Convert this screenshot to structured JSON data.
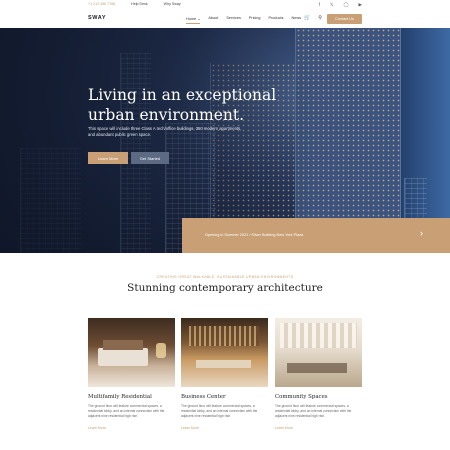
{
  "topbar": {
    "links": [
      "+1 212 456 7788",
      "Help Desk",
      "Why Sway"
    ],
    "social_icons": [
      "facebook-icon",
      "twitter-icon",
      "instagram-icon",
      "youtube-icon"
    ]
  },
  "nav": {
    "logo": "SWAY",
    "menu": [
      "Home",
      "About",
      "Services",
      "Pricing",
      "Products",
      "News"
    ],
    "contact_label": "Contact Us"
  },
  "hero": {
    "title": "Living in an exceptional urban environment.",
    "description": "This space will include three Class A tech/office buildings, 350 modern apartments, and abundant public green space.",
    "learn_more": "Learn More",
    "get_started": "Get Started",
    "ribbon_text": "Opening in Summer 2021 / Silver Building New York Plaza"
  },
  "section": {
    "eyebrow": "CREATING GREAT WALKABLE, SUSTAINABLE URBAN ENVIRONMENTS",
    "title": "Stunning contemporary architecture"
  },
  "cards": [
    {
      "title": "Multifamily Residential",
      "text": "The ground floor will feature commercial spaces, a residential lobby, and an internal connection with the adjacent nine residential high rise.",
      "link": "Learn More"
    },
    {
      "title": "Business Center",
      "text": "The ground floor will feature commercial spaces, a residential lobby, and an internal connection with the adjacent nine residential high rise.",
      "link": "Learn More"
    },
    {
      "title": "Community Spaces",
      "text": "The ground floor will feature commercial spaces, a residential lobby, and an internal connection with the adjacent nine residential high rise.",
      "link": "Learn More"
    }
  ],
  "colors": {
    "accent": "#c9a075",
    "hero_dark": "#1c2740"
  }
}
